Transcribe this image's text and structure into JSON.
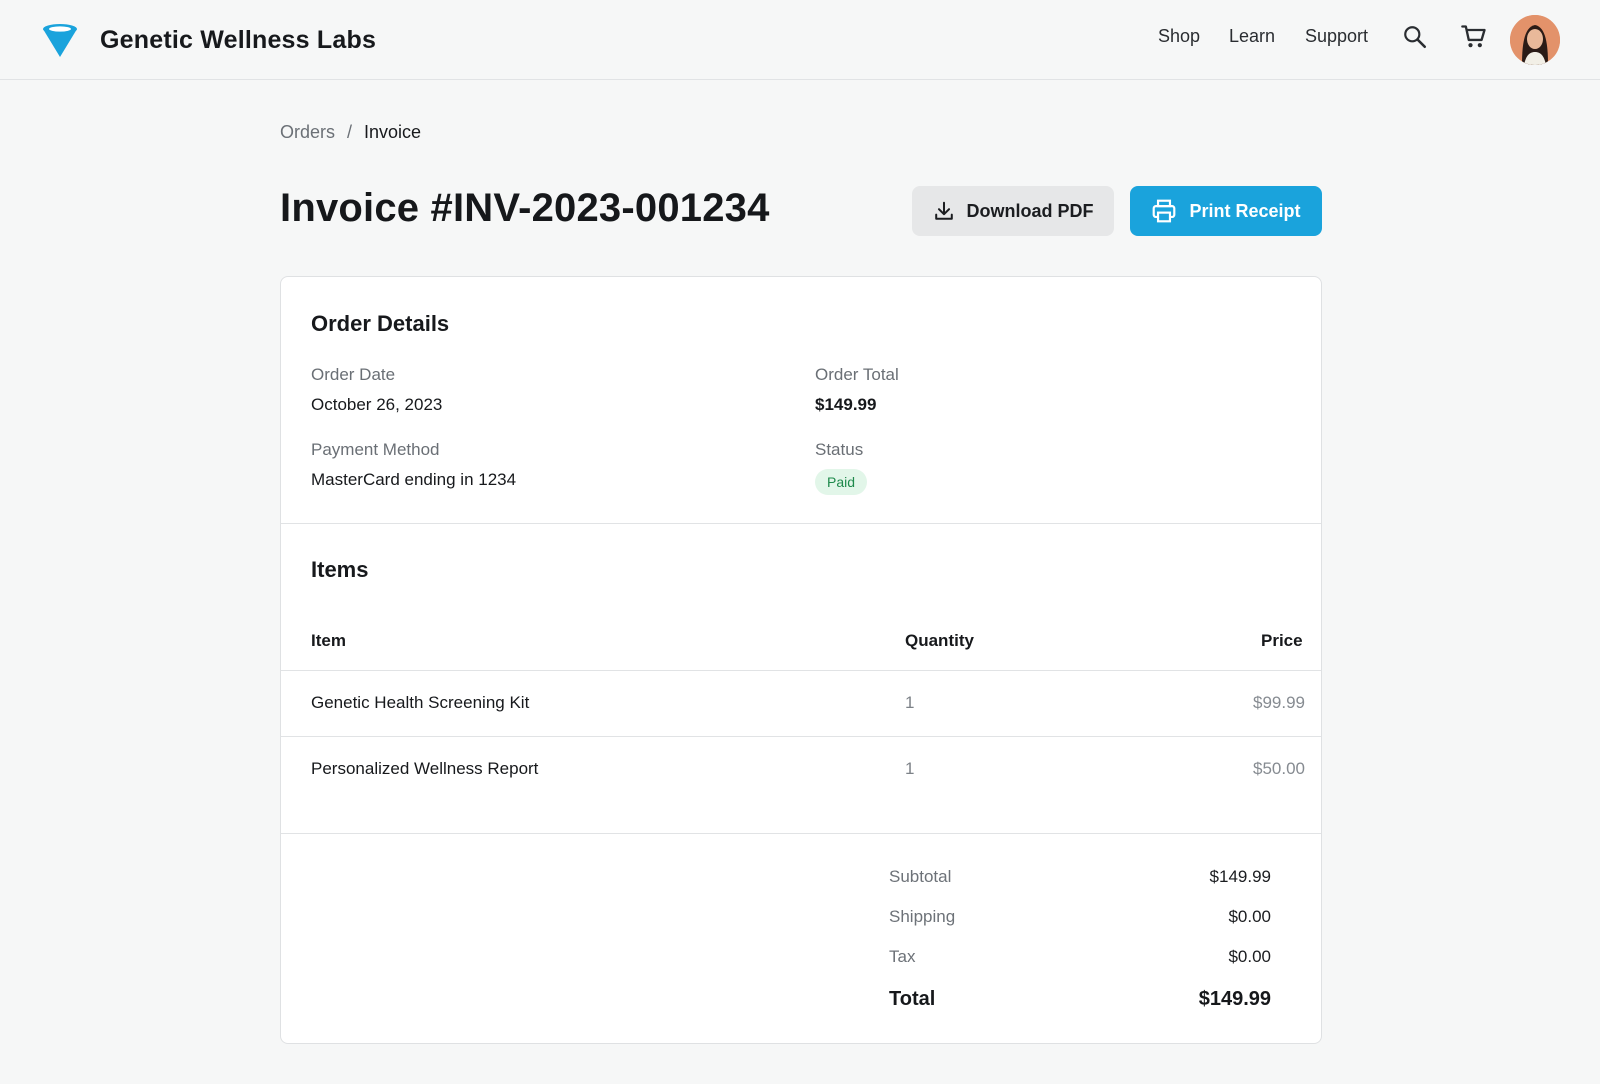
{
  "header": {
    "brand_name": "Genetic Wellness Labs",
    "nav": [
      "Shop",
      "Learn",
      "Support"
    ],
    "icons": [
      "search-icon",
      "cart-icon"
    ],
    "accent_color": "#1aa3dc"
  },
  "breadcrumb": {
    "parent": "Orders",
    "separator": "/",
    "current": "Invoice"
  },
  "page": {
    "title": "Invoice #INV-2023-001234",
    "download_label": "Download PDF",
    "print_label": "Print Receipt"
  },
  "order_details": {
    "title": "Order Details",
    "order_date_label": "Order Date",
    "order_date": "October 26, 2023",
    "order_total_label": "Order Total",
    "order_total": "$149.99",
    "payment_method_label": "Payment Method",
    "payment_method": "MasterCard ending in 1234",
    "status_label": "Status",
    "status": "Paid"
  },
  "items": {
    "title": "Items",
    "columns": [
      "Item",
      "Quantity",
      "Price"
    ],
    "rows": [
      {
        "name": "Genetic Health Screening Kit",
        "quantity": "1",
        "price": "$99.99"
      },
      {
        "name": "Personalized Wellness Report",
        "quantity": "1",
        "price": "$50.00"
      }
    ]
  },
  "summary": {
    "subtotal_label": "Subtotal",
    "subtotal": "$149.99",
    "shipping_label": "Shipping",
    "shipping": "$0.00",
    "tax_label": "Tax",
    "tax": "$0.00",
    "total_label": "Total",
    "total": "$149.99"
  }
}
